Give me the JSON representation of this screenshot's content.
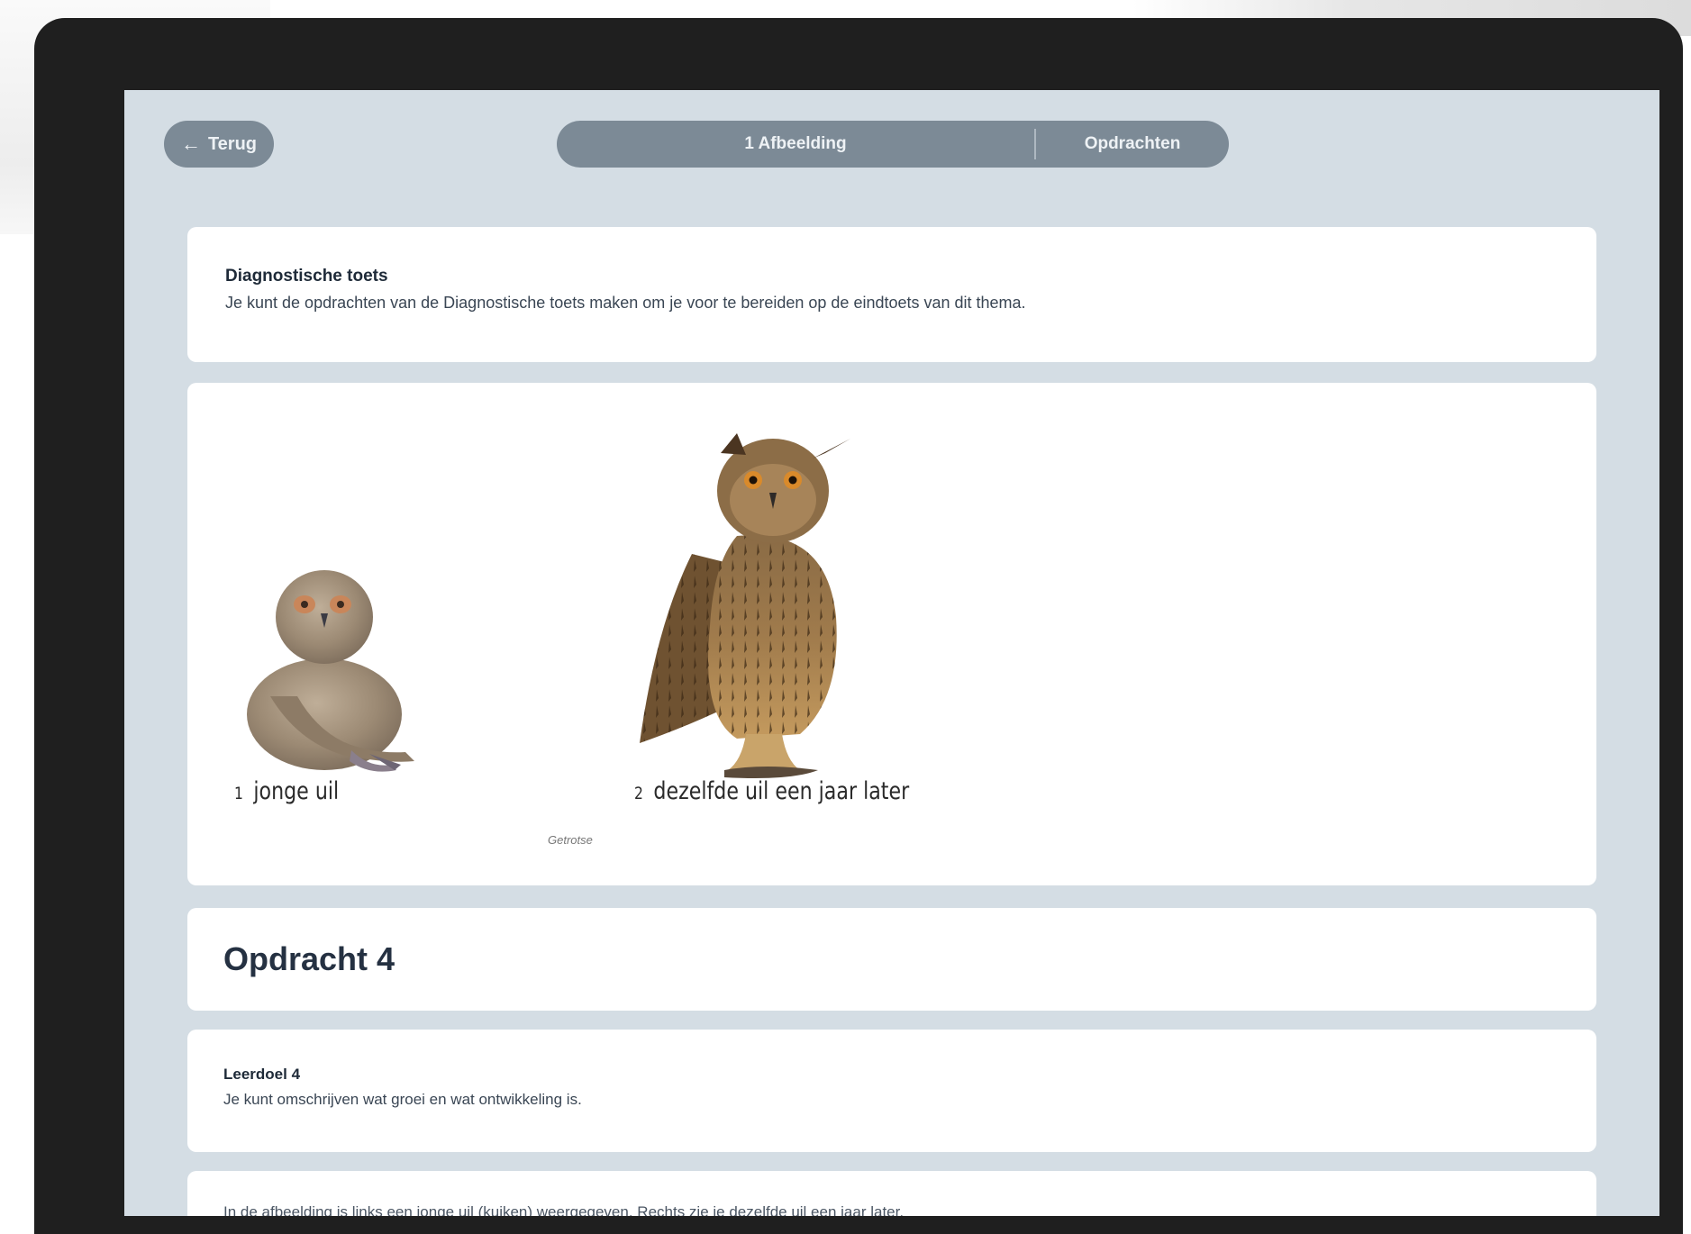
{
  "header": {
    "back_label": "Terug",
    "tabs": [
      {
        "label": "1 Afbeelding"
      },
      {
        "label": "Opdrachten"
      }
    ]
  },
  "intro": {
    "title": "Diagnostische toets",
    "text": "Je kunt de opdrachten van de Diagnostische toets maken om je voor te bereiden op de eindtoets van dit thema."
  },
  "figure": {
    "images": [
      {
        "number": "1",
        "caption": "jonge uil",
        "icon": "young-owl-image"
      },
      {
        "number": "2",
        "caption": "dezelfde uil een jaar later",
        "icon": "adult-owl-image"
      }
    ],
    "credit": "Getrotse"
  },
  "opdracht": {
    "title": "Opdracht 4"
  },
  "leerdoel": {
    "title": "Leerdoel 4",
    "text": "Je kunt omschrijven wat groei en wat ontwikkeling is."
  },
  "next_card": {
    "text": "In de afbeelding is links een jonge uil (kuiken) weergegeven. Rechts zie je dezelfde uil een jaar later."
  },
  "colors": {
    "screen_bg": "#d4dde4",
    "pill": "#7c8a96",
    "device_frame": "#1f1f1f"
  }
}
